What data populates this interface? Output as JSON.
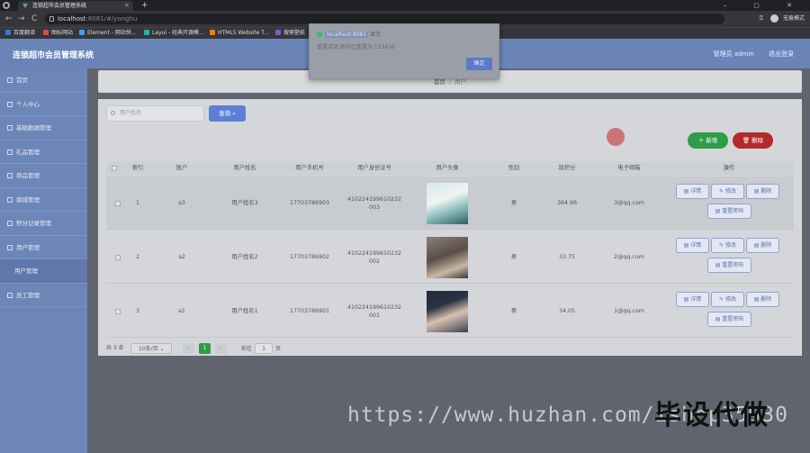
{
  "browser": {
    "tab_title": "连锁超市会员管理系统",
    "tab_close": "×",
    "new_tab": "+",
    "window_controls": "– ▢ ✕",
    "nav": {
      "back": "←",
      "forward": "→",
      "reload": "C"
    },
    "url_host": "localhost",
    "url_rest": ":8081/#/yonghu",
    "profile_label": "无痕模式",
    "bookmarks": [
      {
        "label": "百度翻译",
        "color": "#3b73d9"
      },
      {
        "label": "图标网站",
        "color": "#e04a3a"
      },
      {
        "label": "Element - 网站快...",
        "color": "#409eff"
      },
      {
        "label": "Layui - 经典开源模...",
        "color": "#16baaa"
      },
      {
        "label": "HTML5 Website T...",
        "color": "#ff7a00"
      },
      {
        "label": "搜索壁纸",
        "color": "#7a5cd6"
      }
    ]
  },
  "dialog": {
    "host": "localhost:8081",
    "title_suffix": "显示",
    "message": "重置成功,密码已重置为:123456",
    "ok_label": "确定"
  },
  "header": {
    "brand": "连锁超市会员管理系统",
    "user_label": "管理员 admin",
    "logout_label": "退出登录"
  },
  "sidebar": {
    "items": [
      {
        "label": "首页",
        "icon": "home-icon"
      },
      {
        "label": "个人中心",
        "icon": "user-icon"
      },
      {
        "label": "基础数据管理",
        "icon": "gear-icon"
      },
      {
        "label": "礼品管理",
        "icon": "gift-icon"
      },
      {
        "label": "商品管理",
        "icon": "goods-icon"
      },
      {
        "label": "商城管理",
        "icon": "shop-icon"
      },
      {
        "label": "积分记录管理",
        "icon": "record-icon"
      },
      {
        "label": "用户管理",
        "icon": "users-icon"
      },
      {
        "label": "用户管理",
        "icon": "",
        "sub": true
      },
      {
        "label": "员工管理",
        "icon": "staff-icon"
      }
    ]
  },
  "breadcrumb": {
    "home": "首页",
    "sep": "/",
    "current": "用户"
  },
  "search": {
    "placeholder": "用户姓名",
    "query_label": "查询 ⌕"
  },
  "actions": {
    "add_label": "＋ 新增",
    "delete_label": "🗑 删除"
  },
  "table": {
    "columns": [
      "索引",
      "账户",
      "用户姓名",
      "用户手机号",
      "用户身份证号",
      "用户头像",
      "性别",
      "现积分",
      "电子邮箱",
      "操作"
    ],
    "rows": [
      {
        "index": "1",
        "account": "a3",
        "name": "用户姓名3",
        "phone": "17703786903",
        "id_line1": "410224199610232",
        "id_line2": "003",
        "avatar": "woman-portrait",
        "gender": "男",
        "points": "364.96",
        "email": "3@qq.com"
      },
      {
        "index": "2",
        "account": "a2",
        "name": "用户姓名2",
        "phone": "17703786902",
        "id_line1": "410224199610232",
        "id_line2": "002",
        "avatar": "man-selfie",
        "gender": "男",
        "points": "33.75",
        "email": "2@qq.com"
      },
      {
        "index": "3",
        "account": "a1",
        "name": "用户姓名1",
        "phone": "17703786901",
        "id_line1": "410224199610232",
        "id_line2": "001",
        "avatar": "young-man-portrait",
        "gender": "男",
        "points": "34.05",
        "email": "1@qq.com"
      }
    ],
    "row_actions": {
      "detail": "▤ 详情",
      "edit": "✎ 修改",
      "remove": "▤ 删除",
      "reset": "▤ 重置密码"
    }
  },
  "pagination": {
    "total": "共 3 条",
    "page_size": "10条/页 ⌄",
    "prev": "‹",
    "current": "1",
    "next": "›",
    "goto_prefix": "前往",
    "goto_value": "1",
    "goto_suffix": "页"
  },
  "watermark": {
    "url": "https://www.huzhan.com/ishop35930",
    "text": "毕设代做"
  }
}
